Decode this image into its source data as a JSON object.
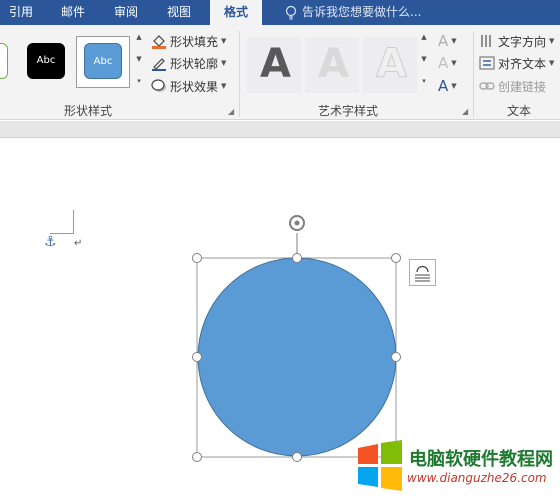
{
  "tabs": [
    {
      "label": "引用"
    },
    {
      "label": "邮件"
    },
    {
      "label": "审阅"
    },
    {
      "label": "视图"
    },
    {
      "label": "格式"
    }
  ],
  "tell_me": {
    "placeholder": "告诉我您想要做什么..."
  },
  "shape_styles": {
    "group_label": "形状样式",
    "swatches": [
      {
        "label": "Abc",
        "color": "#000000"
      },
      {
        "label": "Abc",
        "color": "#5b9bd5"
      }
    ],
    "fill_label": "形状填充",
    "outline_label": "形状轮廓",
    "effects_label": "形状效果"
  },
  "wordart": {
    "group_label": "艺术字样式",
    "letters": [
      "A",
      "A",
      "A"
    ],
    "text_fill_letter": "A",
    "text_outline_letter": "A",
    "text_effects_letter": "A"
  },
  "text_group": {
    "group_label": "文本",
    "direction_label": "文字方向",
    "align_label": "对齐文本",
    "link_label": "创建链接"
  },
  "colors": {
    "accent": "#2b579a",
    "shape_fill": "#5b9bd5",
    "shape_outline": "#41719c",
    "fill_bar": "#e86c2b"
  },
  "watermark": {
    "title": "电脑软硬件教程网",
    "url": "www.dianguzhe26.com"
  }
}
